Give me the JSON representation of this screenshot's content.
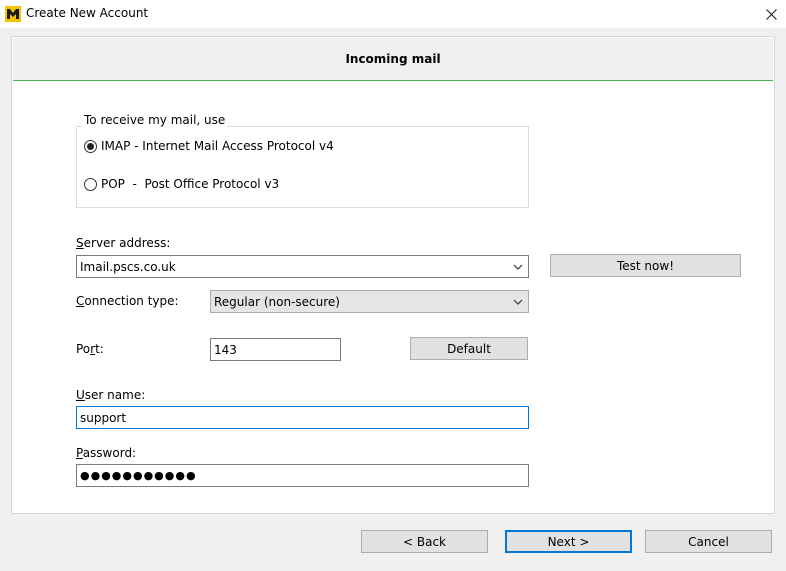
{
  "window": {
    "title": "Create New Account"
  },
  "header": {
    "title": "Incoming mail"
  },
  "protocol_group": {
    "legend": "To receive my mail, use",
    "options": [
      {
        "label": "IMAP - Internet Mail Access Protocol v4",
        "selected": true
      },
      {
        "label": "POP  -  Post Office Protocol v3",
        "selected": false
      }
    ]
  },
  "server": {
    "label_key": "S",
    "label_rest": "erver address:",
    "value": "Imail.pscs.co.uk",
    "test_button": "Test now!"
  },
  "connection": {
    "label_key": "C",
    "label_rest": "onnection type:",
    "value": "Regular (non-secure)"
  },
  "port": {
    "label_pre": "Po",
    "label_key": "r",
    "label_rest": "t:",
    "value": "143",
    "default_button": "Default"
  },
  "username": {
    "label_key": "U",
    "label_rest": "ser name:",
    "value": "support"
  },
  "password": {
    "label_key": "P",
    "label_rest": "assword:",
    "value": "●●●●●●●●●●●"
  },
  "footer": {
    "back": "<  Back",
    "next": "Next  >",
    "cancel": "Cancel"
  }
}
